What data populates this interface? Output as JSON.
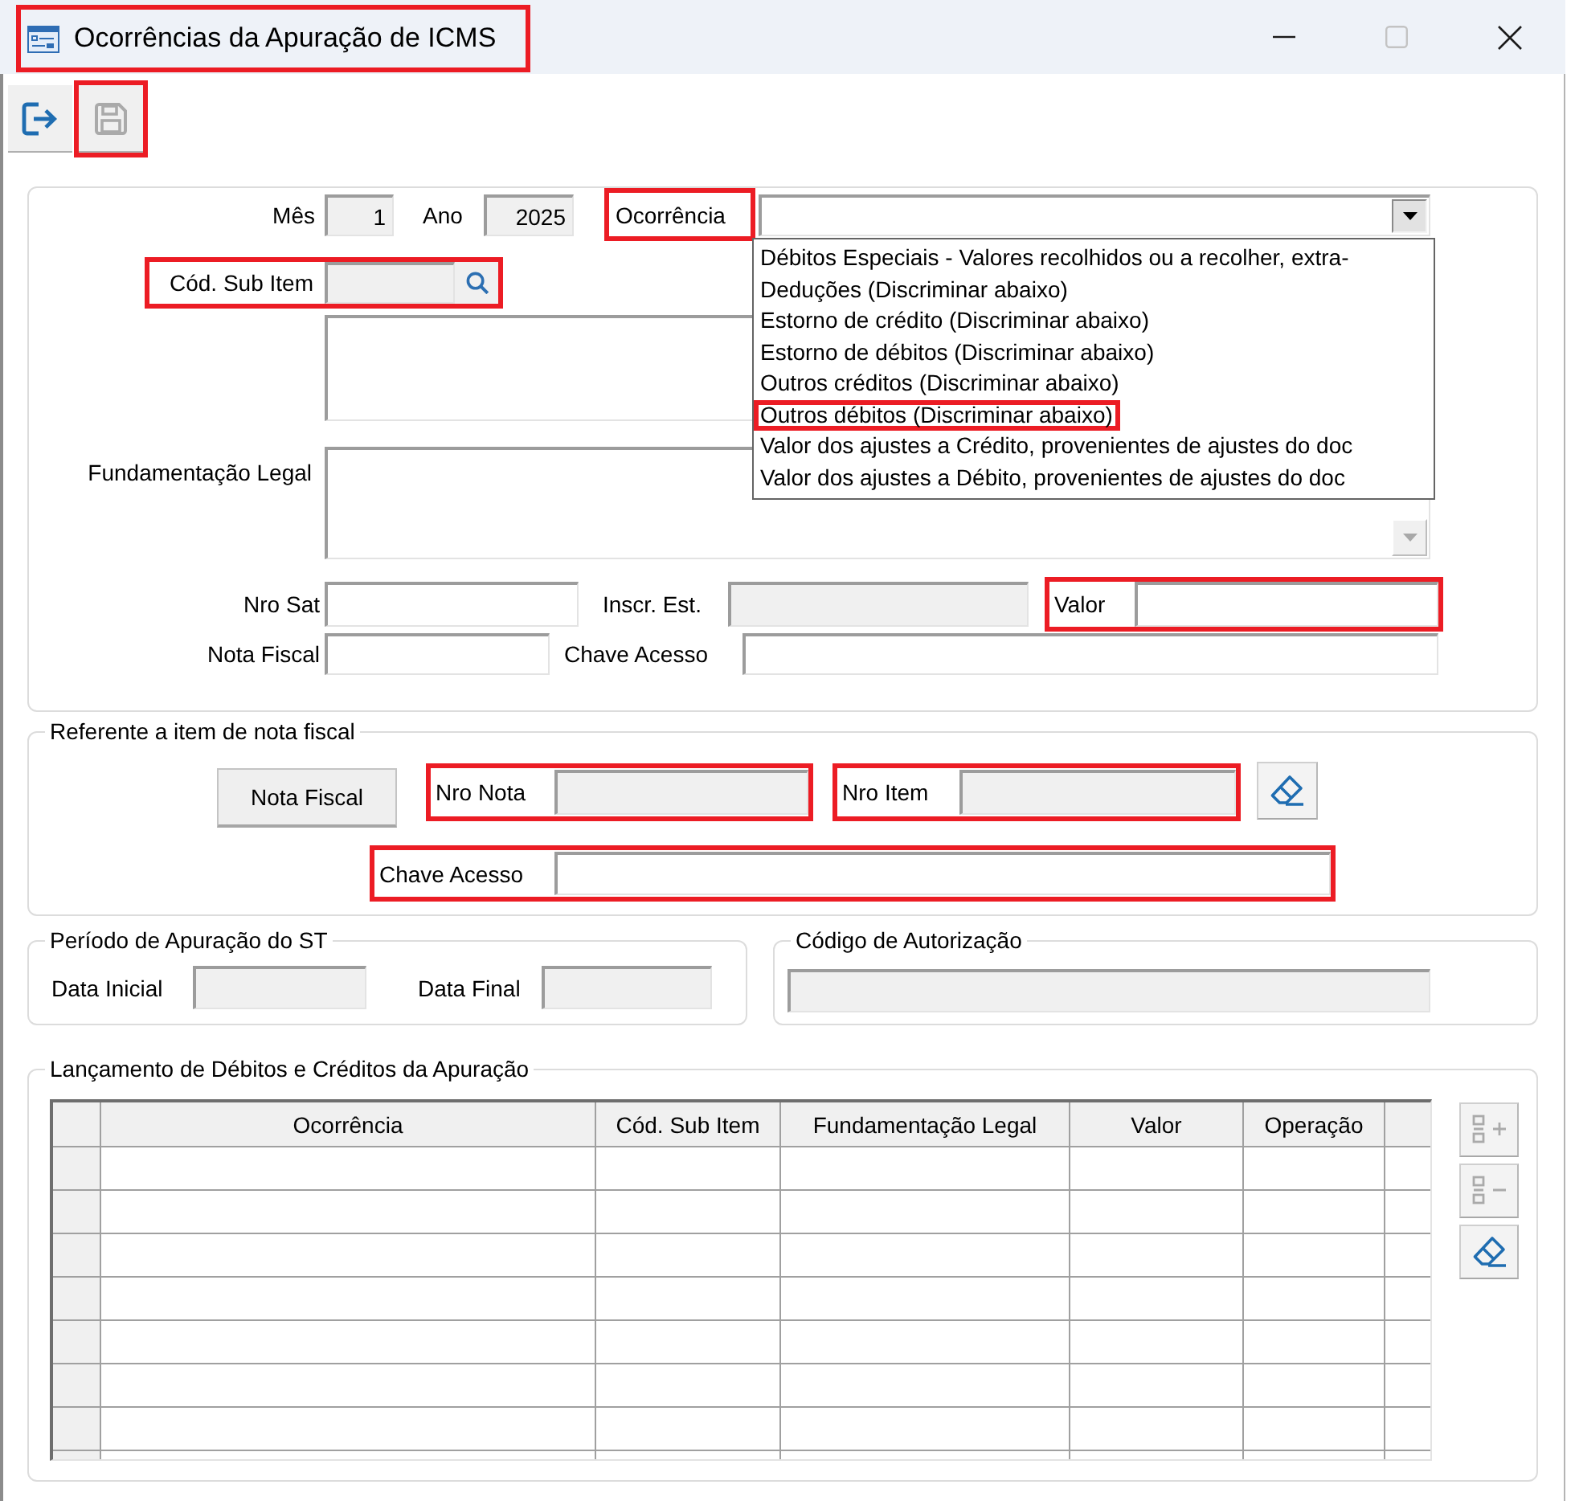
{
  "window": {
    "title": "Ocorrências da Apuração de ICMS",
    "highlighted": true,
    "controls": [
      {
        "kind": "minimize",
        "disabled": false
      },
      {
        "kind": "maximize",
        "disabled": true
      },
      {
        "kind": "close",
        "disabled": false
      }
    ]
  },
  "toolbar": [
    {
      "kind": "exit",
      "disabled": false,
      "highlighted": false
    },
    {
      "kind": "save",
      "disabled": true,
      "highlighted": true
    }
  ],
  "main": {
    "mes": {
      "label": "Mês",
      "value": "1",
      "disabled": true
    },
    "ano": {
      "label": "Ano",
      "value": "2025",
      "disabled": true
    },
    "ocorrencia": {
      "label": "Ocorrência",
      "highlighted": true,
      "expanded": true,
      "options": [
        {
          "text": "Débitos Especiais - Valores recolhidos ou a recolher, extra-",
          "selected": false,
          "highlighted": false
        },
        {
          "text": "Deduções (Discriminar abaixo)",
          "selected": false,
          "highlighted": false
        },
        {
          "text": "Estorno de crédito (Discriminar abaixo)",
          "selected": false,
          "highlighted": false
        },
        {
          "text": "Estorno de débitos (Discriminar abaixo)",
          "selected": false,
          "highlighted": false
        },
        {
          "text": "Outros créditos (Discriminar abaixo)",
          "selected": false,
          "highlighted": false
        },
        {
          "text": "Outros débitos (Discriminar abaixo)",
          "selected": false,
          "highlighted": true
        },
        {
          "text": "Valor dos ajustes a Crédito, provenientes de ajustes do doc",
          "selected": false,
          "highlighted": false
        },
        {
          "text": "Valor dos ajustes a Débito, provenientes de ajustes do doc",
          "selected": false,
          "highlighted": false
        }
      ]
    },
    "cod_sub_item": {
      "label": "Cód. Sub Item",
      "disabled": true,
      "highlighted": true
    },
    "fundamentacao_legal": {
      "label": "Fundamentação Legal"
    },
    "nro_sat": {
      "label": "Nro Sat",
      "disabled": false
    },
    "inscr_est": {
      "label": "Inscr. Est.",
      "disabled": true
    },
    "valor": {
      "label": "Valor",
      "disabled": false,
      "highlighted": true
    },
    "nota_fiscal": {
      "label": "Nota Fiscal",
      "disabled": false
    },
    "chave_acesso": {
      "label": "Chave Acesso",
      "disabled": false
    }
  },
  "referente": {
    "title": "Referente a item de nota fiscal",
    "button": "Nota Fiscal",
    "nro_nota": {
      "label": "Nro Nota",
      "disabled": true,
      "highlighted": true
    },
    "nro_item": {
      "label": "Nro Item",
      "disabled": true,
      "highlighted": true
    },
    "chave_acesso": {
      "label": "Chave Acesso",
      "disabled": false,
      "highlighted": true
    }
  },
  "periodo_st": {
    "title": "Período de Apuração do ST",
    "data_inicial": {
      "label": "Data Inicial",
      "disabled": true
    },
    "data_final": {
      "label": "Data Final",
      "disabled": true
    }
  },
  "codigo_autorizacao": {
    "title": "Código de Autorização",
    "disabled": true
  },
  "lancamentos": {
    "title": "Lançamento de Débitos e Créditos da Apuração",
    "table": {
      "columns": [
        "Ocorrência",
        "Cód. Sub Item",
        "Fundamentação Legal",
        "Valor",
        "Operação"
      ]
    },
    "buttons": [
      {
        "kind": "add-row",
        "disabled": true
      },
      {
        "kind": "remove-row",
        "disabled": true
      },
      {
        "kind": "clear",
        "disabled": false
      }
    ]
  }
}
